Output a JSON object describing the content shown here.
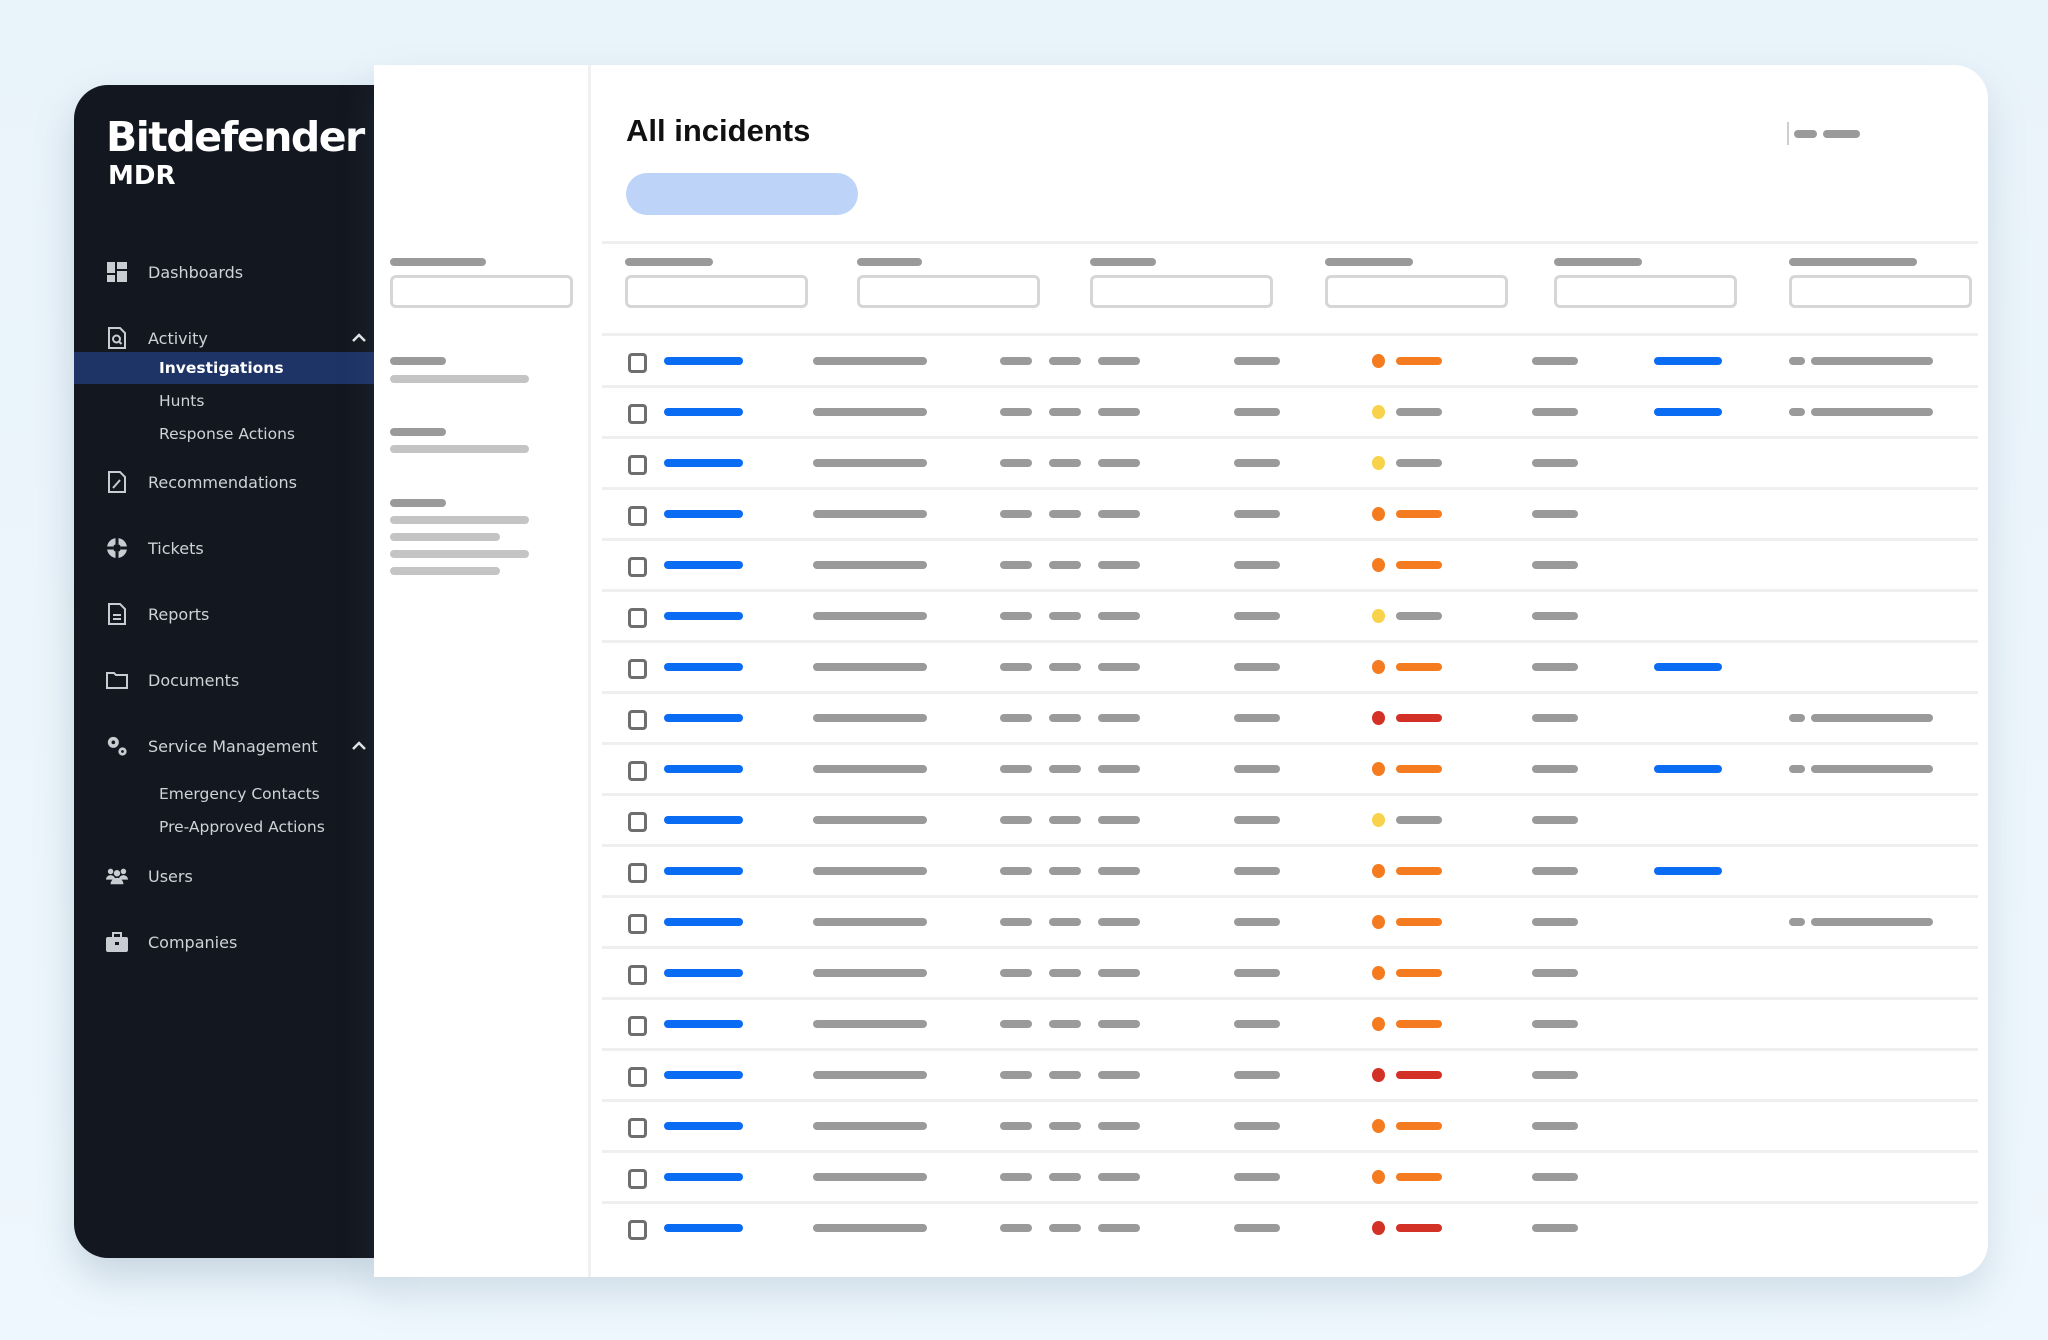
{
  "app": {
    "brand": "Bitdefender",
    "product": "MDR"
  },
  "colors": {
    "link_blue": "#0a6cf2",
    "placeholder_gray": "#9a9a9a",
    "placeholder_light": "#c4c4c4",
    "sidebar_bg": "#13171f",
    "active_bg": "#1e3366",
    "cta_bg": "#bdd4f8",
    "severity": {
      "orange": "#f47b20",
      "yellow": "#f7d24a",
      "red": "#d33026"
    }
  },
  "sidebar": {
    "items": [
      {
        "label": "Dashboards",
        "icon": "dashboard-icon"
      },
      {
        "label": "Activity",
        "icon": "search-document-icon",
        "expanded": true,
        "children": [
          {
            "label": "Investigations",
            "active": true
          },
          {
            "label": "Hunts"
          },
          {
            "label": "Response Actions"
          }
        ]
      },
      {
        "label": "Recommendations",
        "icon": "edit-document-icon"
      },
      {
        "label": "Tickets",
        "icon": "lifebuoy-icon"
      },
      {
        "label": "Reports",
        "icon": "report-icon"
      },
      {
        "label": "Documents",
        "icon": "folder-icon"
      },
      {
        "label": "Service Management",
        "icon": "gears-icon",
        "expanded": true,
        "children": [
          {
            "label": "Emergency Contacts"
          },
          {
            "label": "Pre-Approved Actions"
          }
        ]
      },
      {
        "label": "Users",
        "icon": "users-icon"
      },
      {
        "label": "Companies",
        "icon": "briefcase-icon"
      }
    ]
  },
  "main": {
    "title": "All incidents",
    "rows": [
      {
        "severity": "orange",
        "assignee": true,
        "extra": true
      },
      {
        "severity": "yellow",
        "assignee": true,
        "extra": true
      },
      {
        "severity": "yellow",
        "assignee": false,
        "extra": false
      },
      {
        "severity": "orange",
        "assignee": false,
        "extra": false
      },
      {
        "severity": "orange",
        "assignee": false,
        "extra": false
      },
      {
        "severity": "yellow",
        "assignee": false,
        "extra": false
      },
      {
        "severity": "orange",
        "assignee": true,
        "extra": false
      },
      {
        "severity": "red",
        "assignee": false,
        "extra": true
      },
      {
        "severity": "orange",
        "assignee": true,
        "extra": true
      },
      {
        "severity": "yellow",
        "assignee": false,
        "extra": false
      },
      {
        "severity": "orange",
        "assignee": true,
        "extra": false
      },
      {
        "severity": "orange",
        "assignee": false,
        "extra": true
      },
      {
        "severity": "orange",
        "assignee": false,
        "extra": false
      },
      {
        "severity": "orange",
        "assignee": false,
        "extra": false
      },
      {
        "severity": "red",
        "assignee": false,
        "extra": false
      },
      {
        "severity": "orange",
        "assignee": false,
        "extra": false
      },
      {
        "severity": "orange",
        "assignee": false,
        "extra": false
      },
      {
        "severity": "red",
        "assignee": false,
        "extra": false
      }
    ]
  }
}
